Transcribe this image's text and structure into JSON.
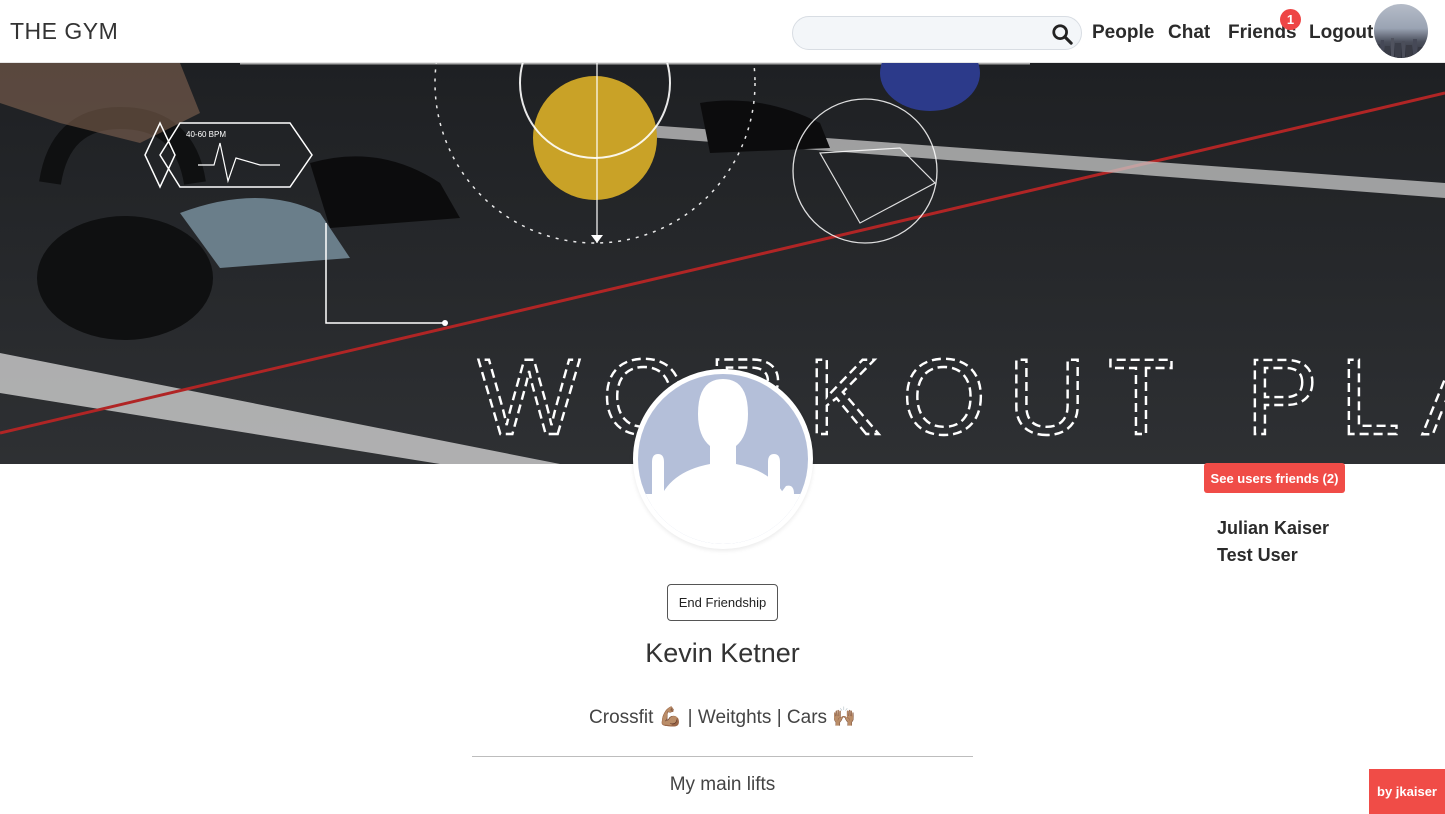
{
  "navbar": {
    "brand": "THE GYM",
    "search": {
      "value": "",
      "placeholder": ""
    },
    "links": {
      "people": "People",
      "chat": "Chat",
      "friends": "Friends",
      "logout": "Logout"
    },
    "friend_requests_badge": "1"
  },
  "cover": {
    "title_text": "WORKOUT PLAN",
    "bpm_text": "40-60 BPM"
  },
  "profile": {
    "end_friendship_label": "End Friendship",
    "name": "Kevin Ketner",
    "bio": "Crossfit 💪🏽 | Weitghts | Cars 🙌🏽",
    "main_lifts_heading": "My main lifts"
  },
  "friends_panel": {
    "button_label": "See users friends (2)",
    "friends": [
      "Julian Kaiser",
      "Test User"
    ]
  },
  "credit": "by jkaiser",
  "colors": {
    "accent": "#f04c47",
    "badge": "#ee4545"
  }
}
